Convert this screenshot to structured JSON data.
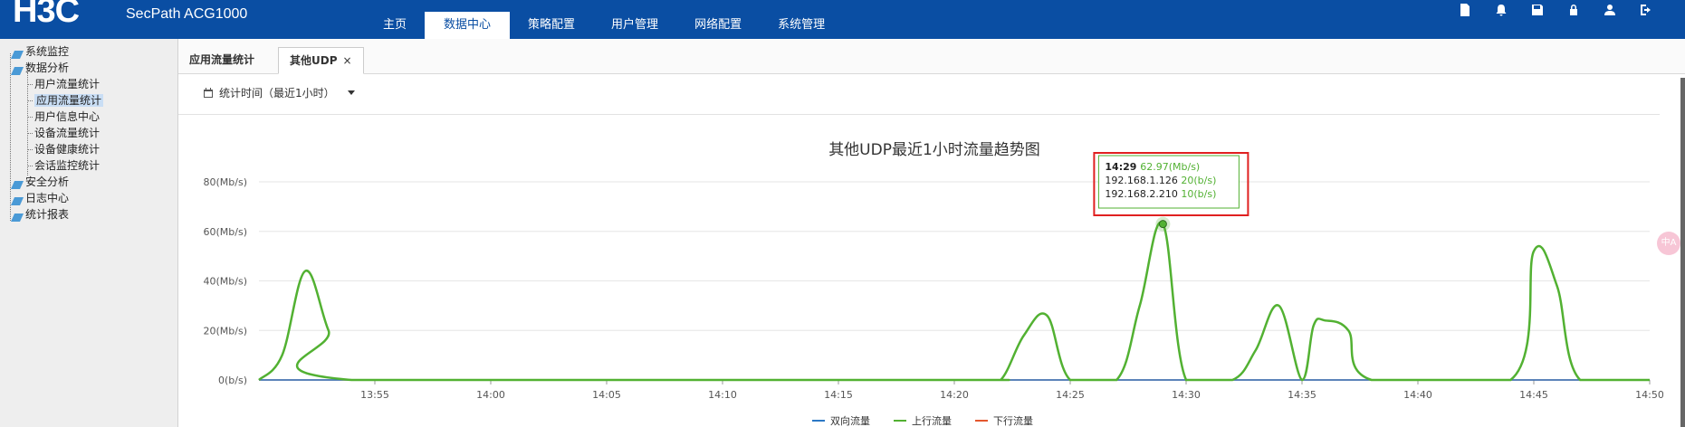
{
  "header": {
    "logo": "H3C",
    "product": "SecPath ACG1000",
    "nav": [
      "主页",
      "数据中心",
      "策略配置",
      "用户管理",
      "网络配置",
      "系统管理"
    ],
    "nav_active_index": 1,
    "icons": [
      "document-icon",
      "bell-icon",
      "save-icon",
      "lock-icon",
      "user-icon",
      "logout-icon"
    ]
  },
  "sidebar": {
    "items": [
      {
        "label": "系统监控",
        "level": 0
      },
      {
        "label": "数据分析",
        "level": 0
      },
      {
        "label": "用户流量统计",
        "level": 1
      },
      {
        "label": "应用流量统计",
        "level": 1,
        "selected": true
      },
      {
        "label": "用户信息中心",
        "level": 1
      },
      {
        "label": "设备流量统计",
        "level": 1
      },
      {
        "label": "设备健康统计",
        "level": 1
      },
      {
        "label": "会话监控统计",
        "level": 1
      },
      {
        "label": "安全分析",
        "level": 0
      },
      {
        "label": "日志中心",
        "level": 0
      },
      {
        "label": "统计报表",
        "level": 0
      }
    ]
  },
  "tabs": [
    {
      "label": "应用流量统计",
      "closable": false
    },
    {
      "label": "其他UDP",
      "closable": true,
      "active": true
    }
  ],
  "tab_close_glyph": "×",
  "filter": {
    "label": "统计时间（最近1小时）"
  },
  "float_button": {
    "label": "中A"
  },
  "colors": {
    "header": "#0a4ea3",
    "bidirectional": "#2b78c5",
    "upstream": "#52b132",
    "downstream": "#e4572e",
    "highlight": "#e02020"
  },
  "chart_data": {
    "type": "line",
    "title": "其他UDP最近1小时流量趋势图",
    "ylim": [
      0,
      80
    ],
    "y_ticks": [
      "0(b/s)",
      "20(Mb/s)",
      "40(Mb/s)",
      "60(Mb/s)",
      "80(Mb/s)"
    ],
    "y_tick_values": [
      0,
      20,
      40,
      60,
      80
    ],
    "x_ticks": [
      "13:55",
      "14:00",
      "14:05",
      "14:10",
      "14:15",
      "14:20",
      "14:25",
      "14:30",
      "14:35",
      "14:40",
      "14:45",
      "14:50"
    ],
    "x_range_minutes": [
      "13:50",
      "14:50"
    ],
    "grid": true,
    "legend_position": "bottom",
    "series": [
      {
        "name": "双向流量",
        "color": "#2b78c5",
        "points": [
          [
            "13:50",
            0
          ],
          [
            "14:50",
            0
          ]
        ]
      },
      {
        "name": "上行流量",
        "color": "#52b132",
        "points": [
          [
            "13:50",
            0
          ],
          [
            "13:51",
            10
          ],
          [
            "13:52",
            44
          ],
          [
            "13:53",
            20
          ],
          [
            "13:54",
            0
          ],
          [
            "14:20",
            0
          ],
          [
            "14:21",
            0
          ],
          [
            "14:22",
            0
          ],
          [
            "14:23",
            18
          ],
          [
            "14:24",
            26
          ],
          [
            "14:25",
            0
          ],
          [
            "14:27",
            0
          ],
          [
            "14:28",
            30
          ],
          [
            "14:29",
            62.97
          ],
          [
            "14:30",
            0
          ],
          [
            "14:32",
            0
          ],
          [
            "14:33",
            12
          ],
          [
            "14:34",
            30
          ],
          [
            "14:35",
            0
          ],
          [
            "14:35.5",
            22
          ],
          [
            "14:36",
            24
          ],
          [
            "14:37",
            20
          ],
          [
            "14:38",
            0
          ],
          [
            "14:44",
            0
          ],
          [
            "14:45",
            52
          ],
          [
            "14:46",
            38
          ],
          [
            "14:47",
            0
          ],
          [
            "14:50",
            0
          ]
        ]
      },
      {
        "name": "下行流量",
        "color": "#e4572e",
        "points": [
          [
            "13:50",
            0
          ],
          [
            "14:50",
            0
          ]
        ]
      }
    ],
    "tooltip": {
      "time": "14:29",
      "value": "62.97(Mb/s)",
      "rows": [
        {
          "ip": "192.168.1.126",
          "value": "20(b/s)"
        },
        {
          "ip": "192.168.2.210",
          "value": "10(b/s)"
        }
      ]
    }
  }
}
